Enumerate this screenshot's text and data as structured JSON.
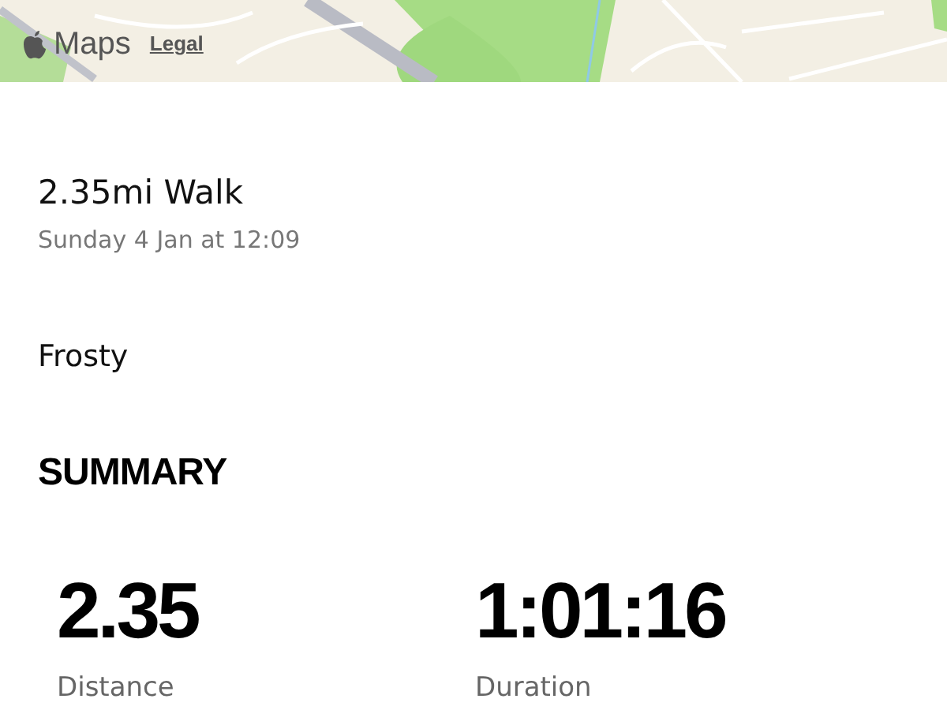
{
  "map": {
    "kind": "picture",
    "attribution": {
      "brand": "Maps",
      "legal": "Legal"
    }
  },
  "workout": {
    "title": "2.35mi Walk",
    "date": "Sunday 4 Jan at 12:09",
    "note": "Frosty"
  },
  "summary": {
    "heading": "SUMMARY",
    "stats": [
      {
        "value": "2.35",
        "label": "Distance"
      },
      {
        "value": "1:01:16",
        "label": "Duration"
      }
    ]
  }
}
